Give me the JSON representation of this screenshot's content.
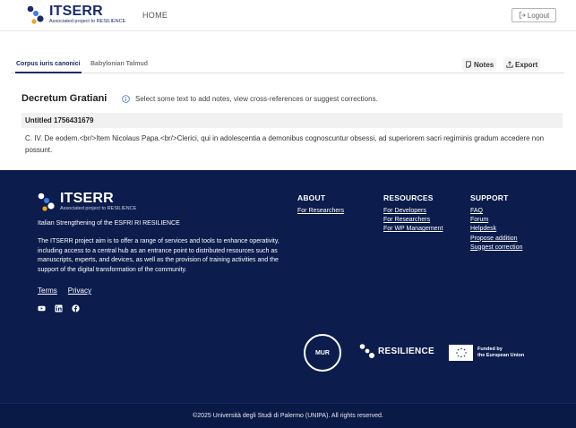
{
  "header": {
    "logo_title": "ITSERR",
    "logo_subtitle": "Associated project to RESILIENCE",
    "home_label": "HOME",
    "logout_label": "Logout"
  },
  "tabs": [
    {
      "label": "Corpus iuris canonici",
      "active": true
    },
    {
      "label": "Babylonian Talmud",
      "active": false
    }
  ],
  "toolbar": {
    "notes_label": "Notes",
    "export_label": "Export"
  },
  "document": {
    "title": "Decretum Gratiani",
    "info_text": "Select some text to add notes, view cross-references or suggest corrections.",
    "section_title": "Untitled 1756431679",
    "body": "C. IV. De eodem.<br/>Item Nicolaus Papa.<br/>Clerici, qui in adolescentia a demonibus cognoscuntur obsessi, ad superiorem sacri regiminis gradum accedere non possunt."
  },
  "footer": {
    "logo_title": "ITSERR",
    "logo_subtitle": "Associated project to RESILIENCE",
    "tagline": "Italian Strengthening of the ESFRI RI RESILIENCE",
    "description": "The ITSERR project aim is to offer a range of services and tools to enhance operativity, including access to a central hub as an entrance point to distributed resources such as manuscripts, experts, and devices, as well as the provision of training activities and the support of the digital transformation of the community.",
    "terms_label": "Terms",
    "privacy_label": "Privacy",
    "social_icons": [
      "youtube-icon",
      "linkedin-icon",
      "facebook-icon"
    ],
    "about": {
      "heading": "ABOUT",
      "links": [
        "For Researchers"
      ]
    },
    "resources": {
      "heading": "RESOURCES",
      "links": [
        "For Developers",
        "For Researchers",
        "For WP Management"
      ]
    },
    "support": {
      "heading": "SUPPORT",
      "links": [
        "FAQ",
        "Forum",
        "Helpdesk",
        "Propose addition",
        "Suggest correction"
      ]
    },
    "partners": {
      "mur": "MUR",
      "resilience": "RESILIENCE",
      "eu_line1": "Funded by",
      "eu_line2": "the European Union"
    },
    "copyright": "©2025 Università degli Studi di Palermo (UNIPA). All rights reserved."
  },
  "colors": {
    "brand_navy": "#1b2a6b",
    "footer_bg": "#0b1c4d",
    "accent_orange": "#f2a31b",
    "accent_blue": "#3b7de0"
  }
}
